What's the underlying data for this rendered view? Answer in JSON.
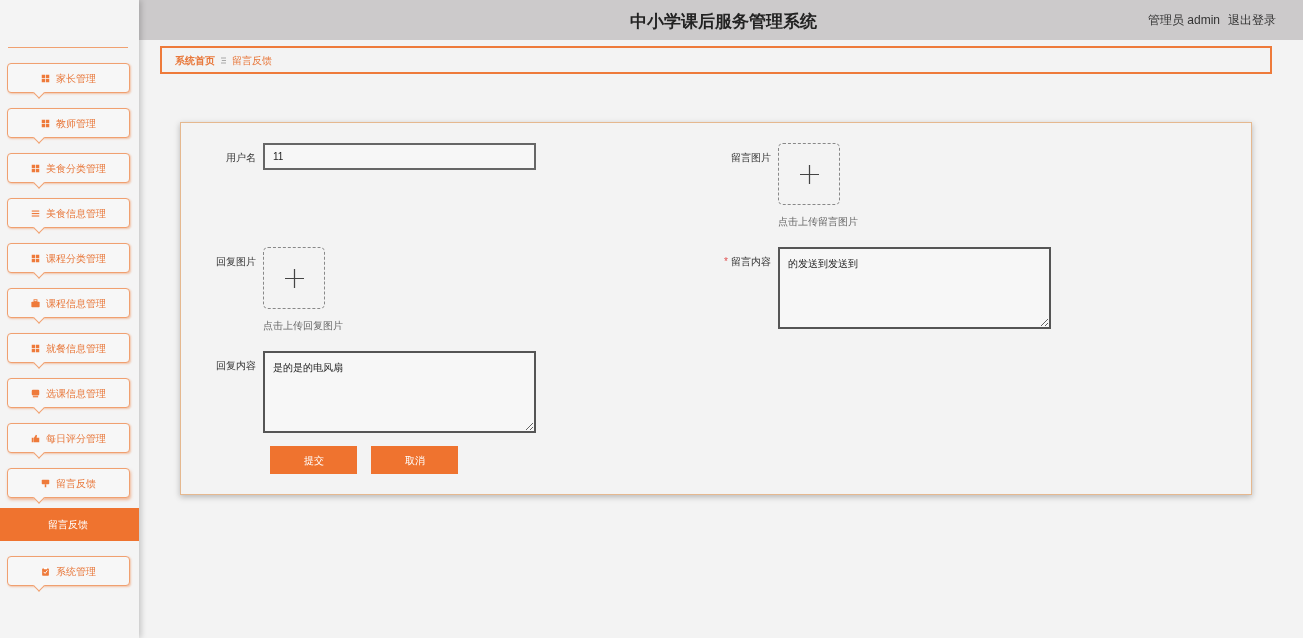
{
  "header": {
    "title": "中小学课后服务管理系统",
    "user": "管理员 admin",
    "logout": "退出登录"
  },
  "sidebar": {
    "items": [
      {
        "label": "家长管理",
        "kind": "grid",
        "expanded": false
      },
      {
        "label": "教师管理",
        "kind": "grid",
        "expanded": false
      },
      {
        "label": "美食分类管理",
        "kind": "grid",
        "expanded": false
      },
      {
        "label": "美食信息管理",
        "kind": "list",
        "expanded": false
      },
      {
        "label": "课程分类管理",
        "kind": "grid",
        "expanded": false
      },
      {
        "label": "课程信息管理",
        "kind": "briefcase",
        "expanded": false
      },
      {
        "label": "就餐信息管理",
        "kind": "grid",
        "expanded": false
      },
      {
        "label": "选课信息管理",
        "kind": "monitor",
        "expanded": false
      },
      {
        "label": "每日评分管理",
        "kind": "thumb",
        "expanded": false
      },
      {
        "label": "留言反馈",
        "kind": "sign",
        "expanded": true,
        "children": [
          {
            "label": "留言反馈",
            "selected": true
          }
        ]
      },
      {
        "label": "系统管理",
        "kind": "clipboard",
        "expanded": false
      }
    ]
  },
  "breadcrumb": [
    {
      "label": "系统首页"
    },
    {
      "label": "留言反馈"
    }
  ],
  "form": {
    "left_fields": [
      {
        "kind": "text",
        "label": "用户名",
        "value": "11"
      },
      {
        "kind": "upload",
        "label": "回复图片",
        "hint": "点击上传回复图片"
      },
      {
        "kind": "textarea",
        "label": "回复内容",
        "value": "是的是的电风扇"
      }
    ],
    "right_fields": [
      {
        "kind": "upload",
        "label": "留言图片",
        "hint": "点击上传留言图片"
      },
      {
        "kind": "textarea",
        "label": "留言内容",
        "value": "的发送到发送到",
        "required_mark": "*"
      }
    ],
    "buttons": [
      {
        "label": "提交"
      },
      {
        "label": "取消"
      }
    ]
  }
}
